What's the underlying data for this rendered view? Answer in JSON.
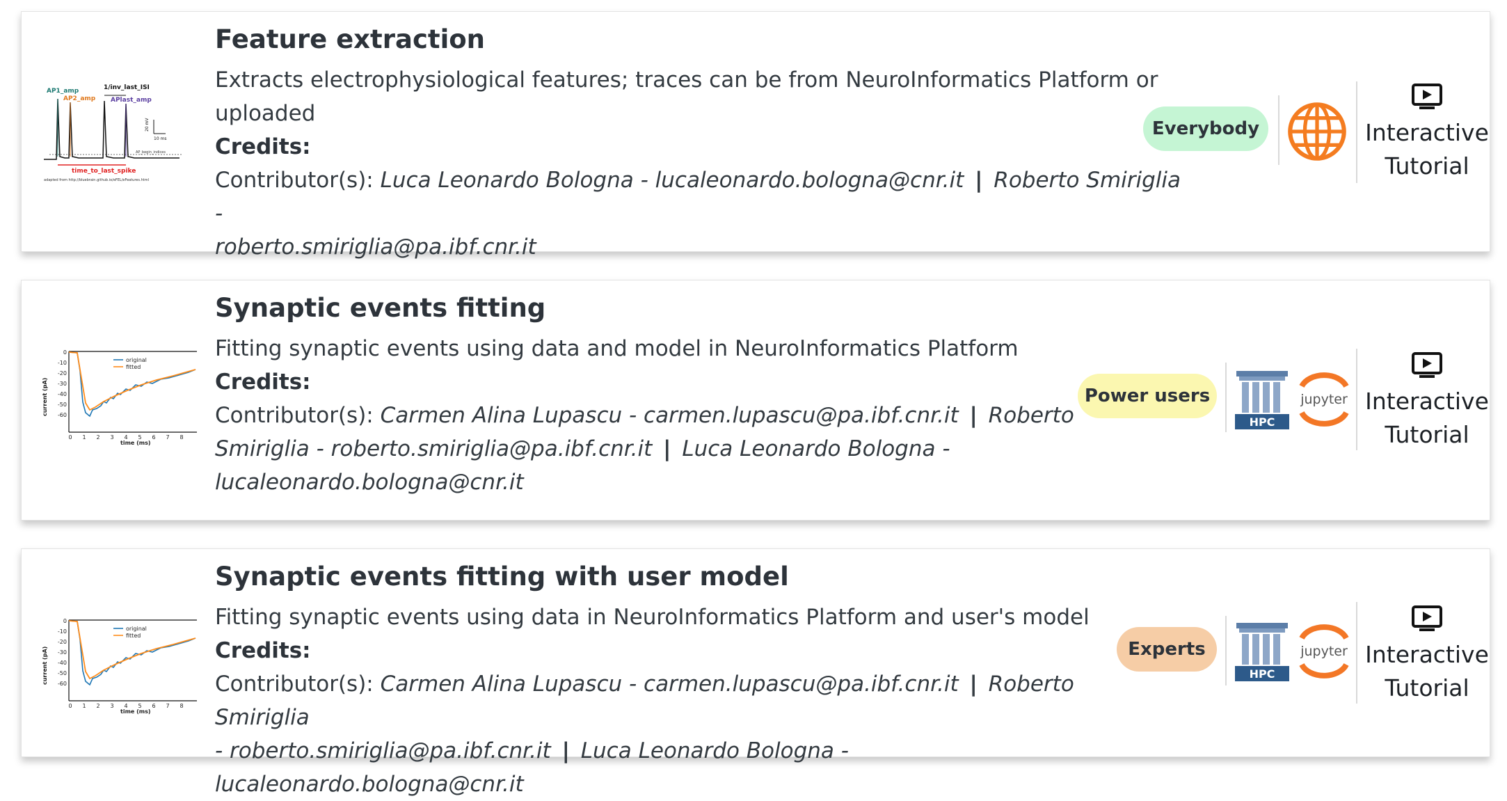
{
  "colors": {
    "everybody": "#c5f5d4",
    "power_users": "#fbf7b0",
    "experts": "#f6cda6",
    "web_orange": "#f47c20",
    "hpc_blue": "#2d5a8a",
    "jupyter_orange": "#f37726"
  },
  "cards": [
    {
      "title": "Feature extraction",
      "description_line1": "Extracts electrophysiological features; traces can be from NeuroInformatics Platform or",
      "description_line2": "uploaded",
      "credits_label": "Credits:",
      "contrib_label": "Contributor(s):",
      "contrib_line1": "Luca Leonardo Bologna - lucaleonardo.bologna@cnr.it",
      "contrib_sep1": "|",
      "contrib_line1b": "Roberto Smiriglia -",
      "contrib_line2": "roberto.smiriglia@pa.ibf.cnr.it",
      "badge": "Everybody",
      "icons": [
        "globe-icon"
      ],
      "tutorial_line1": "Interactive",
      "tutorial_line2": "Tutorial",
      "thumb_labels": {
        "ap1": "AP1_amp",
        "ap2": "AP2_amp",
        "inv": "1/inv_last_ISI",
        "aplast": "APlast_amp",
        "scale_v": "20 mV",
        "scale_t": "10 ms",
        "begin": "AP_begin_indices",
        "ttls": "time_to_last_spike",
        "source": "adapted from http://bluebrain.github.io/eFEL/eFeatures.html"
      }
    },
    {
      "title": "Synaptic events fitting",
      "description_line1": "Fitting synaptic events using data and model in NeuroInformatics Platform",
      "credits_label": "Credits:",
      "contrib_label": "Contributor(s):",
      "contrib_line1": "Carmen Alina Lupascu - carmen.lupascu@pa.ibf.cnr.it",
      "contrib_sep1": "|",
      "contrib_line1b": "Roberto",
      "contrib_line2": "Smiriglia - roberto.smiriglia@pa.ibf.cnr.it",
      "contrib_sep2": "|",
      "contrib_line2b": "Luca Leonardo Bologna -",
      "contrib_line3": "lucaleonardo.bologna@cnr.it",
      "badge": "Power users",
      "icons": [
        "hpc-icon",
        "jupyter-icon"
      ],
      "hpc_label": "HPC",
      "jupyter_label": "jupyter",
      "tutorial_line1": "Interactive",
      "tutorial_line2": "Tutorial",
      "thumb": {
        "legend_original": "original",
        "legend_fitted": "fitted",
        "ylabel": "current (pA)",
        "xlabel": "time (ms)",
        "yticks": [
          "0",
          "-10",
          "-20",
          "-30",
          "-40",
          "-50",
          "-60"
        ],
        "xticks": [
          "0",
          "1",
          "2",
          "3",
          "4",
          "5",
          "6",
          "7",
          "8"
        ]
      }
    },
    {
      "title": "Synaptic events fitting with user model",
      "description_line1": "Fitting synaptic events using data in NeuroInformatics Platform and user's model",
      "credits_label": "Credits:",
      "contrib_label": "Contributor(s):",
      "contrib_line1": "Carmen Alina Lupascu - carmen.lupascu@pa.ibf.cnr.it",
      "contrib_sep1": "|",
      "contrib_line1b": "Roberto Smiriglia",
      "contrib_line2a": "- roberto.smiriglia@pa.ibf.cnr.it",
      "contrib_sep2": "|",
      "contrib_line2b": "Luca Leonardo Bologna - lucaleonardo.bologna@cnr.it",
      "badge": "Experts",
      "icons": [
        "hpc-icon",
        "jupyter-icon"
      ],
      "hpc_label": "HPC",
      "jupyter_label": "jupyter",
      "tutorial_line1": "Interactive",
      "tutorial_line2": "Tutorial",
      "thumb": {
        "legend_original": "original",
        "legend_fitted": "fitted",
        "ylabel": "current (pA)",
        "xlabel": "time (ms)",
        "yticks": [
          "0",
          "-10",
          "-20",
          "-30",
          "-40",
          "-50",
          "-60"
        ],
        "xticks": [
          "0",
          "1",
          "2",
          "3",
          "4",
          "5",
          "6",
          "7",
          "8"
        ]
      }
    }
  ]
}
